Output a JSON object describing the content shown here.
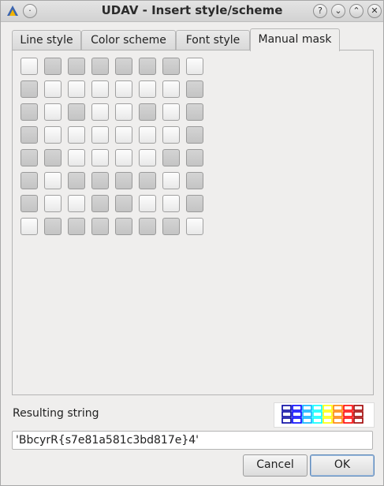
{
  "window": {
    "title": "UDAV - Insert style/scheme",
    "buttons": [
      "?",
      "⌄",
      "⌃",
      "✕"
    ]
  },
  "tabs": [
    {
      "label": "Line style",
      "active": false
    },
    {
      "label": "Color scheme",
      "active": false
    },
    {
      "label": "Font style",
      "active": false
    },
    {
      "label": "Manual mask",
      "active": true
    }
  ],
  "mask": {
    "rows": [
      [
        1,
        0,
        0,
        0,
        0,
        0,
        0,
        1
      ],
      [
        0,
        1,
        1,
        1,
        1,
        1,
        1,
        0
      ],
      [
        0,
        1,
        0,
        1,
        1,
        0,
        1,
        0
      ],
      [
        0,
        1,
        1,
        1,
        1,
        1,
        1,
        0
      ],
      [
        0,
        0,
        1,
        1,
        1,
        1,
        0,
        0
      ],
      [
        0,
        1,
        0,
        0,
        0,
        0,
        1,
        0
      ],
      [
        0,
        1,
        1,
        0,
        0,
        1,
        1,
        0
      ],
      [
        1,
        0,
        0,
        0,
        0,
        0,
        0,
        1
      ]
    ]
  },
  "result": {
    "label": "Resulting string",
    "value": "'BbcyrR{s7e81a581c3bd817e}4'",
    "preview_colors": [
      "#0000a0",
      "#0000ff",
      "#00b0ff",
      "#00ffff",
      "#ffff00",
      "#ff8000",
      "#ff0000",
      "#a00000"
    ]
  },
  "actions": {
    "cancel_label": "Cancel",
    "ok_label": "OK"
  }
}
